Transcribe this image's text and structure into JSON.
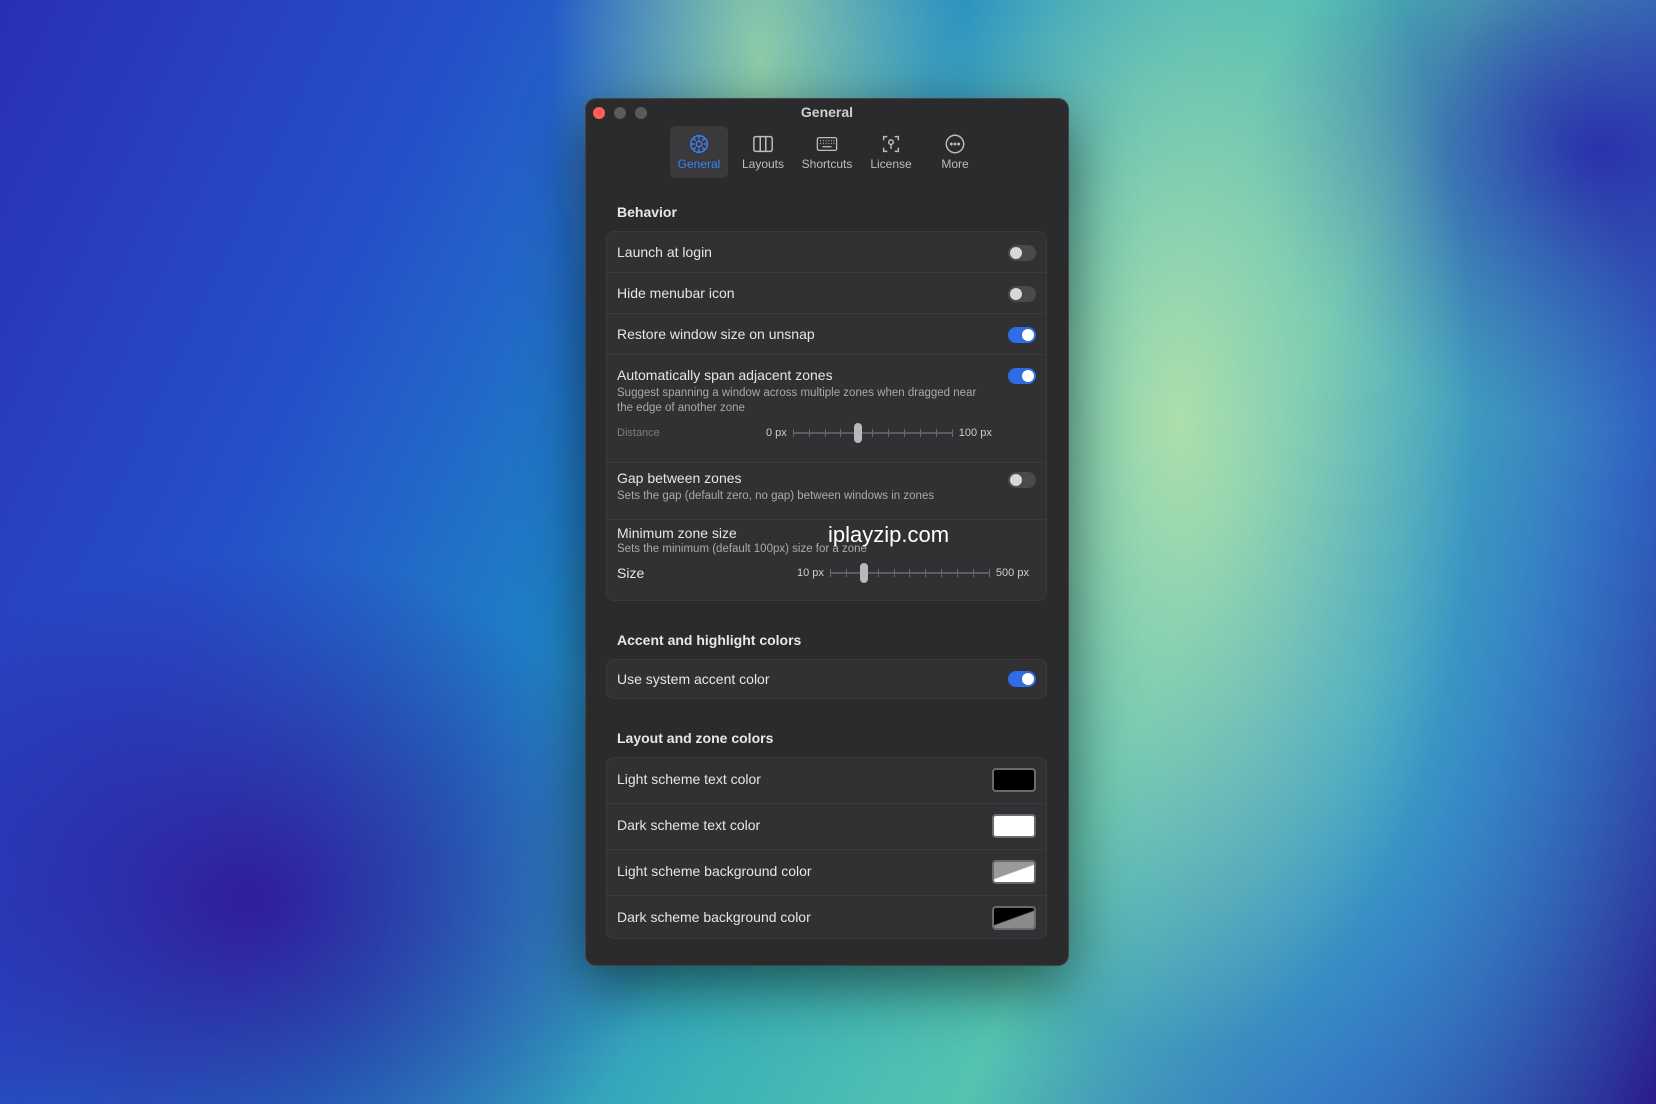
{
  "window": {
    "title": "General"
  },
  "toolbar": {
    "items": [
      {
        "label": "General",
        "icon": "gear-icon",
        "active": true
      },
      {
        "label": "Layouts",
        "icon": "columns-icon"
      },
      {
        "label": "Shortcuts",
        "icon": "keyboard-icon"
      },
      {
        "label": "License",
        "icon": "license-icon"
      },
      {
        "label": "More",
        "icon": "ellipsis-circle-icon"
      }
    ]
  },
  "behavior": {
    "title": "Behavior",
    "launch_at_login": {
      "label": "Launch at login",
      "on": false
    },
    "hide_menubar_icon": {
      "label": "Hide menubar icon",
      "on": false
    },
    "restore_window_size": {
      "label": "Restore window size on unsnap",
      "on": true
    },
    "span_zones": {
      "label": "Automatically span adjacent zones",
      "description": "Suggest spanning a window across multiple zones when dragged near the edge of another zone",
      "on": true,
      "distance": {
        "label": "Distance",
        "min": "0 px",
        "max": "100 px",
        "value_fraction": 0.4
      }
    },
    "gap_between_zones": {
      "label": "Gap between zones",
      "description": "Sets the gap (default zero, no gap) between windows in zones",
      "on": false
    },
    "min_zone_size": {
      "label": "Minimum zone size",
      "description": "Sets the minimum (default 100px) size for a zone",
      "size": {
        "label": "Size",
        "min": "10 px",
        "max": "500 px",
        "value_fraction": 0.2
      }
    }
  },
  "accent": {
    "title": "Accent and highlight colors",
    "use_system_accent": {
      "label": "Use system accent color",
      "on": true
    }
  },
  "layout_colors": {
    "title": "Layout and zone colors",
    "light_text": {
      "label": "Light scheme text color",
      "color": "#000000"
    },
    "dark_text": {
      "label": "Dark scheme text color",
      "color": "#ffffff"
    },
    "light_bg": {
      "label": "Light scheme background color"
    },
    "dark_bg": {
      "label": "Dark scheme background color"
    }
  },
  "watermark": "iplayzip.com",
  "colors": {
    "accent": "#2f6de6",
    "close": "#ff5f57"
  }
}
